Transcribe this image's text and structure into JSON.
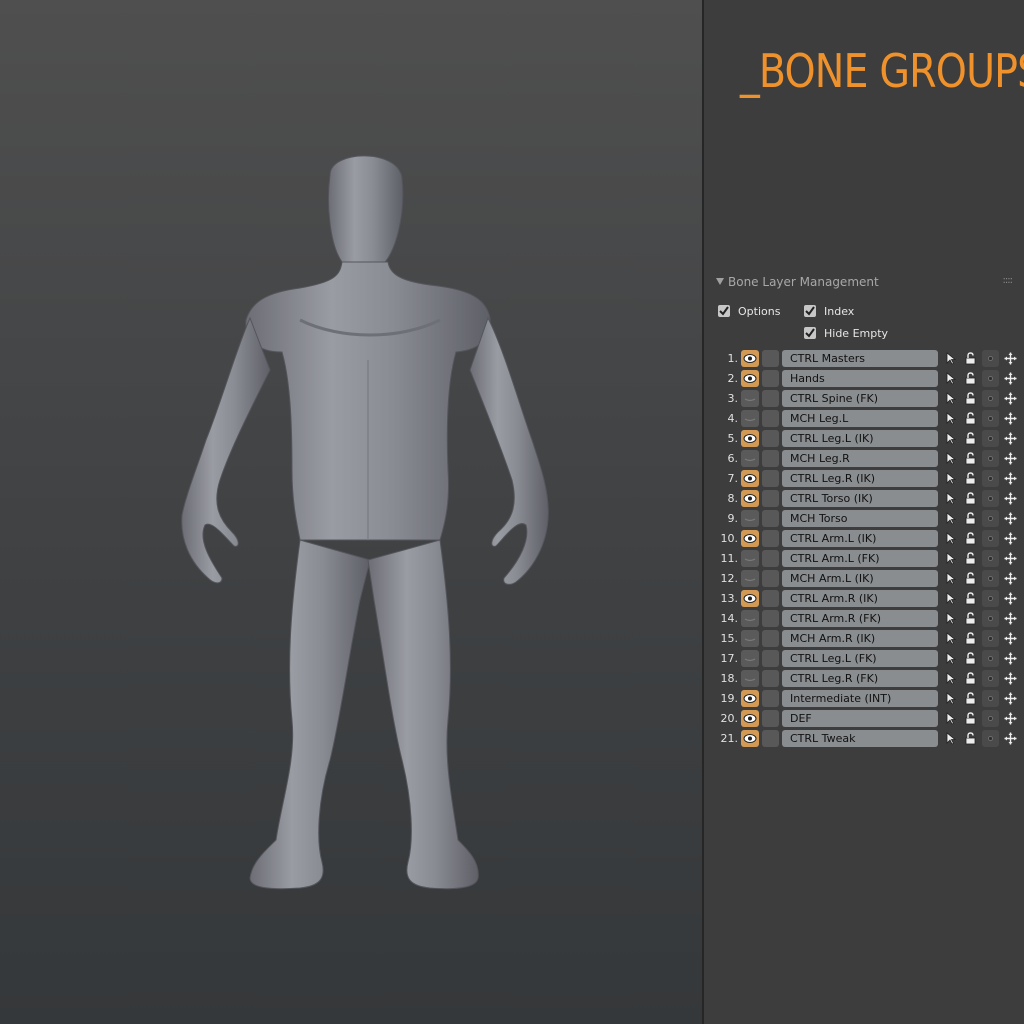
{
  "banner": {
    "title": "_BONE GROUPS"
  },
  "panel": {
    "section_title": "Bone Layer Management",
    "grip": "::::",
    "options_label": "Options",
    "index_label": "Index",
    "hide_empty_label": "Hide Empty",
    "options_checked": true,
    "index_checked": true,
    "hide_empty_checked": true
  },
  "layers": [
    {
      "num": "1.",
      "name": "CTRL Masters",
      "visible": true
    },
    {
      "num": "2.",
      "name": "Hands",
      "visible": true
    },
    {
      "num": "3.",
      "name": "CTRL Spine (FK)",
      "visible": false
    },
    {
      "num": "4.",
      "name": "MCH Leg.L",
      "visible": false
    },
    {
      "num": "5.",
      "name": "CTRL Leg.L (IK)",
      "visible": true
    },
    {
      "num": "6.",
      "name": "MCH Leg.R",
      "visible": false
    },
    {
      "num": "7.",
      "name": "CTRL Leg.R (IK)",
      "visible": true
    },
    {
      "num": "8.",
      "name": "CTRL Torso (IK)",
      "visible": true
    },
    {
      "num": "9.",
      "name": "MCH Torso",
      "visible": false
    },
    {
      "num": "10.",
      "name": "CTRL Arm.L (IK)",
      "visible": true
    },
    {
      "num": "11.",
      "name": "CTRL Arm.L (FK)",
      "visible": false
    },
    {
      "num": "12.",
      "name": "MCH Arm.L (IK)",
      "visible": false
    },
    {
      "num": "13.",
      "name": "CTRL Arm.R (IK)",
      "visible": true
    },
    {
      "num": "14.",
      "name": "CTRL Arm.R (FK)",
      "visible": false
    },
    {
      "num": "15.",
      "name": "MCH Arm.R (IK)",
      "visible": false
    },
    {
      "num": "17.",
      "name": "CTRL Leg.L (FK)",
      "visible": false
    },
    {
      "num": "18.",
      "name": "CTRL Leg.R (FK)",
      "visible": false
    },
    {
      "num": "19.",
      "name": "Intermediate (INT)",
      "visible": true
    },
    {
      "num": "20.",
      "name": "DEF",
      "visible": true
    },
    {
      "num": "21.",
      "name": "CTRL Tweak",
      "visible": true
    }
  ],
  "colors": {
    "accent": "#f0922c",
    "eye_on": "#d29a55",
    "eye_off": "#5a5a5a",
    "field": "#8a8d90",
    "panel_bg": "#3d3d3d"
  }
}
